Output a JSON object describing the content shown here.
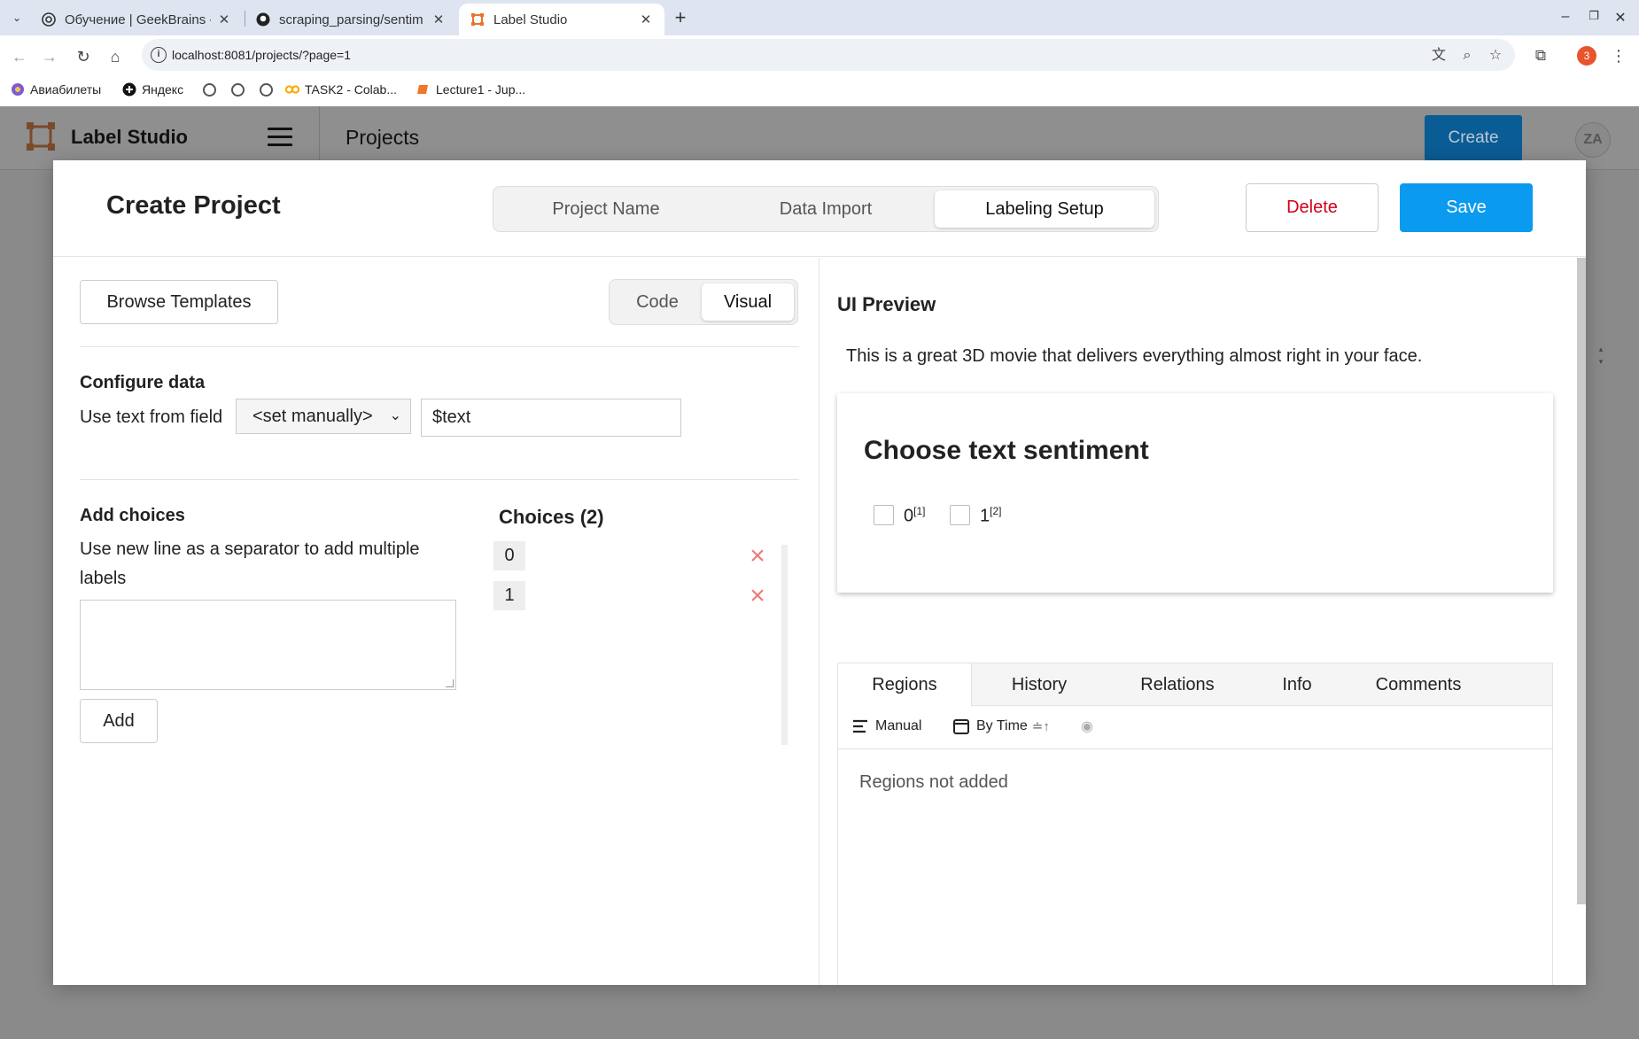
{
  "browser": {
    "tabs": [
      {
        "title": "Обучение | GeekBrains -",
        "icon": "geekbrains-icon"
      },
      {
        "title": "scraping_parsing/sentim",
        "icon": "github-icon"
      },
      {
        "title": "Label Studio",
        "icon": "label-studio-icon",
        "active": true
      }
    ],
    "url": "localhost:8081/projects/?page=1",
    "extension_badge": "3",
    "bookmarks": [
      {
        "label": "Авиабилеты",
        "icon": "aviasales-icon"
      },
      {
        "label": "Яндекс",
        "icon": "yandex-icon"
      },
      {
        "label": "",
        "icon": "globe-icon"
      },
      {
        "label": "",
        "icon": "globe-icon"
      },
      {
        "label": "",
        "icon": "globe-icon"
      },
      {
        "label": "TASK2 - Colab...",
        "icon": "colab-icon"
      },
      {
        "label": "Lecture1 - Jup...",
        "icon": "jupyter-icon"
      }
    ]
  },
  "app": {
    "name": "Label Studio",
    "page_title": "Projects",
    "create_label": "Create",
    "avatar_initials": "ZA",
    "accent_color": "#0a9af0"
  },
  "modal": {
    "title": "Create Project",
    "steps": [
      "Project Name",
      "Data Import",
      "Labeling Setup"
    ],
    "active_step": "Labeling Setup",
    "delete_label": "Delete",
    "save_label": "Save",
    "left": {
      "browse_templates_label": "Browse Templates",
      "modes": [
        "Code",
        "Visual"
      ],
      "active_mode": "Visual",
      "configure_data_title": "Configure data",
      "use_text_from_field_label": "Use text from field",
      "field_select_value": "<set manually>",
      "field_value": "$text",
      "add_choices_title": "Add choices",
      "add_choices_hint": "Use new line as a separator to add multiple labels",
      "add_label": "Add",
      "choices_title": "Choices (2)",
      "choices": [
        "0",
        "1"
      ]
    },
    "right": {
      "preview_title": "UI Preview",
      "preview_text": "This is a great 3D movie that delivers everything almost right in your face.",
      "choice_card_title": "Choose text sentiment",
      "choice_options": [
        {
          "label": "0",
          "hotkey": "[1]"
        },
        {
          "label": "1",
          "hotkey": "[2]"
        }
      ],
      "panel_tabs": [
        "Regions",
        "History",
        "Relations",
        "Info",
        "Comments"
      ],
      "active_panel_tab": "Regions",
      "filter_manual": "Manual",
      "filter_by_time": "By Time",
      "empty_message": "Regions not added"
    }
  }
}
